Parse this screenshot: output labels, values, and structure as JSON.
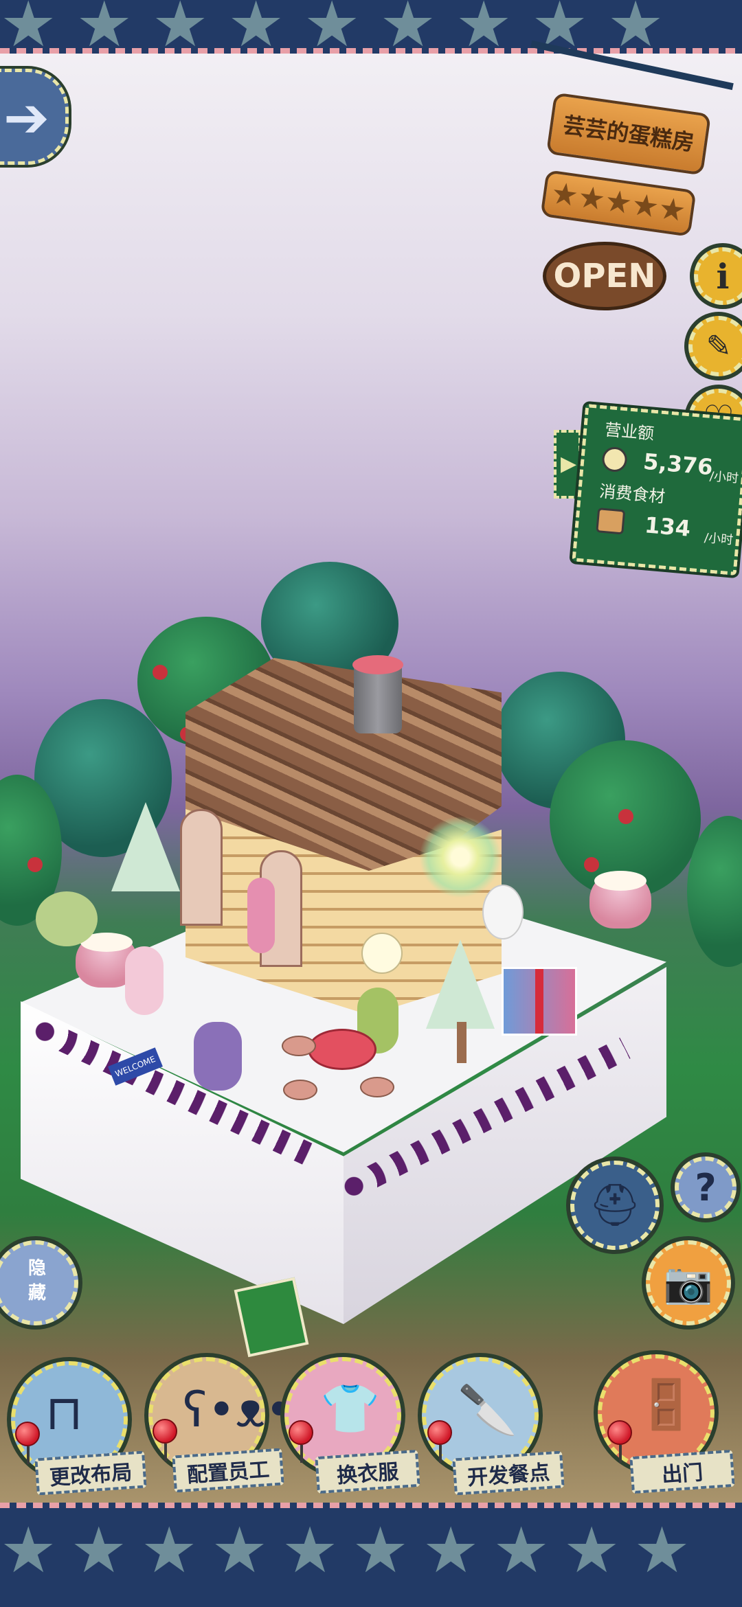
{
  "top_band": {
    "stars": "★★★★★★★★★"
  },
  "bottom_band": {
    "stars": "★★★★★★★★★★"
  },
  "shop": {
    "name": "芸芸的蛋糕房",
    "rating_stars": "★★★★★",
    "status_sign": "OPEN"
  },
  "side_buttons": {
    "info": "i",
    "book": "✎",
    "heart": "♡",
    "help": "?",
    "hide_label": "隐藏"
  },
  "stats": {
    "revenue_label": "营业额",
    "revenue_value": "5,376",
    "revenue_unit": "/小时",
    "ingredients_label": "消费食材",
    "ingredients_value": "134",
    "ingredients_unit": "/小时"
  },
  "scene": {
    "welcome_mat": "WELCOME"
  },
  "bottom_menu": [
    {
      "label": "更改布局",
      "icon": "table-icon",
      "color": "#8fb8d8"
    },
    {
      "label": "配置员工",
      "icon": "bear-icon",
      "color": "#d8b890"
    },
    {
      "label": "换衣服",
      "icon": "shirt-icon",
      "color": "#e8a8c0"
    },
    {
      "label": "开发餐点",
      "icon": "knife-icon",
      "color": "#a8c8e0"
    },
    {
      "label": "出门",
      "icon": "door-icon",
      "color": "#e07a5a"
    }
  ],
  "colors": {
    "board_green": "#1f6a3c",
    "band_blue": "#223a66",
    "stitch_yellow": "#e9e6a8"
  }
}
